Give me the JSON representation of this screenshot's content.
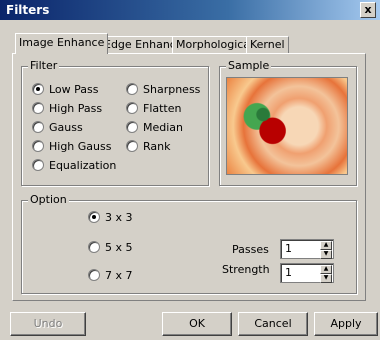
{
  "window": {
    "title": "Filters",
    "close": "x"
  },
  "tabs": [
    "Image Enhance",
    "Edge Enhance",
    "Morphological",
    "Kernel"
  ],
  "filter_group": {
    "legend": "Filter",
    "options": [
      "Low Pass",
      "High Pass",
      "Gauss",
      "High Gauss",
      "Equalization",
      "Sharpness",
      "Flatten",
      "Median",
      "Rank"
    ],
    "selected": "Low Pass"
  },
  "sample_group": {
    "legend": "Sample"
  },
  "option_group": {
    "legend": "Option",
    "sizes": [
      "3 x 3",
      "5 x 5",
      "7 x 7"
    ],
    "selected": "3 x 3",
    "passes_label": "Passes",
    "passes_value": "1",
    "strength_label": "Strength",
    "strength_value": "1"
  },
  "buttons": {
    "undo": "Undo",
    "ok": "OK",
    "cancel": "Cancel",
    "apply": "Apply"
  }
}
